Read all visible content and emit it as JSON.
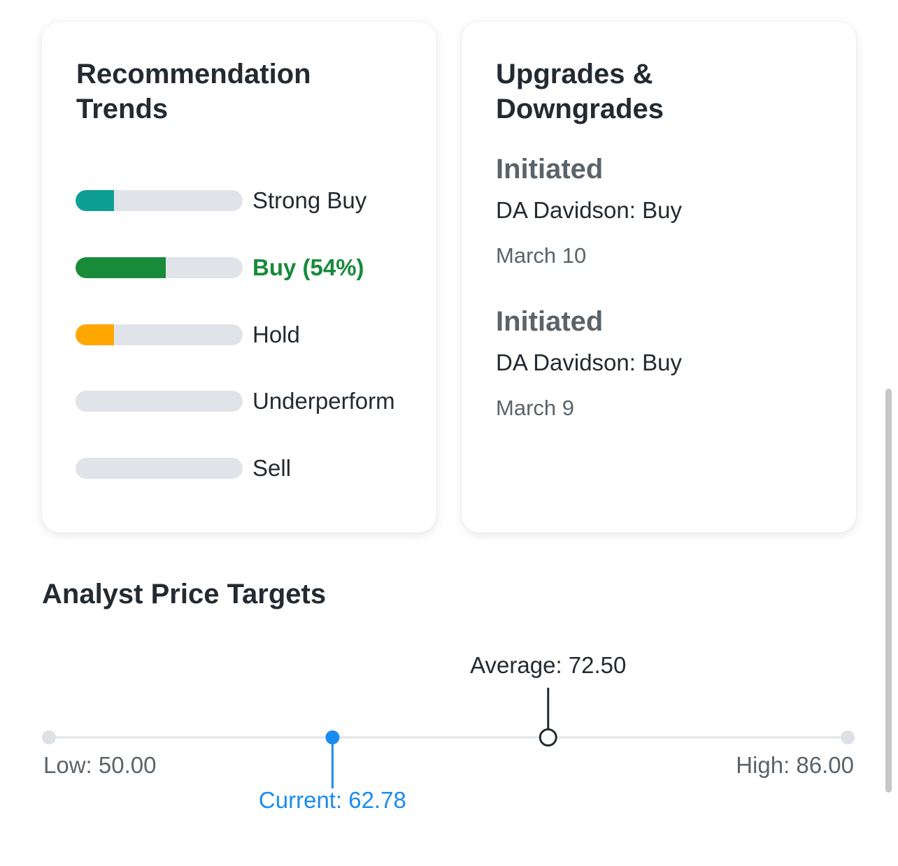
{
  "recommendation_trends": {
    "title": "Recommendation Trends",
    "items": [
      {
        "label": "Strong Buy",
        "fraction": 0.23,
        "color": "#0e9e95",
        "active": false
      },
      {
        "label": "Buy (54%)",
        "fraction": 0.54,
        "color": "#188a3a",
        "active": true
      },
      {
        "label": "Hold",
        "fraction": 0.23,
        "color": "#ffa700",
        "active": false
      },
      {
        "label": "Underperform",
        "fraction": 0,
        "color": "#e0e4e9",
        "active": false
      },
      {
        "label": "Sell",
        "fraction": 0,
        "color": "#e0e4e9",
        "active": false
      }
    ]
  },
  "upgrades_downgrades": {
    "title": "Upgrades & Downgrades",
    "items": [
      {
        "action": "Initiated",
        "firm": "DA Davidson: Buy",
        "date": "March 10"
      },
      {
        "action": "Initiated",
        "firm": "DA Davidson: Buy",
        "date": "March 9"
      }
    ]
  },
  "analyst_price_targets": {
    "title": "Analyst Price Targets",
    "low_label": "Low: 50.00",
    "current_label": "Current: 62.78",
    "average_label": "Average: 72.50",
    "high_label": "High: 86.00"
  },
  "chart_data": {
    "type": "scatter",
    "title": "Analyst Price Targets",
    "xlim": [
      50.0,
      86.0
    ],
    "points": [
      {
        "name": "Low",
        "x": 50.0,
        "label": "Low: 50.00"
      },
      {
        "name": "Current",
        "x": 62.78,
        "label": "Current: 62.78"
      },
      {
        "name": "Average",
        "x": 72.5,
        "label": "Average: 72.50"
      },
      {
        "name": "High",
        "x": 86.0,
        "label": "High: 86.00"
      }
    ],
    "colors": {
      "track": "#e0e4e9",
      "current": "#1a8cf0",
      "average": "#232a31",
      "endpoint": "#dde1e6",
      "label": "#5b636a"
    }
  }
}
